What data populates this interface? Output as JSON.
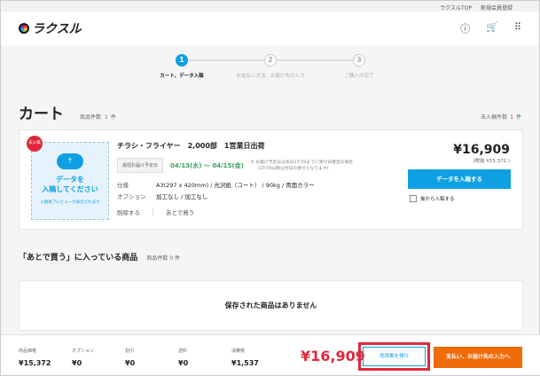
{
  "topbar": {
    "links": [
      "ラクスルTOP",
      "新規会員登録"
    ]
  },
  "header": {
    "logo": "ラクスル",
    "icons": [
      "help-icon",
      "cart-icon",
      "apps-grid-icon"
    ]
  },
  "stepper": {
    "current": 1,
    "steps": [
      {
        "num": "1",
        "label": "カート、データ入稿"
      },
      {
        "num": "2",
        "label": "お支払い方法、お届け先の入力"
      },
      {
        "num": "3",
        "label": "ご購入の完了"
      }
    ]
  },
  "cart": {
    "title": "カート",
    "count_label": "商品件数",
    "count": "1",
    "count_unit": "件",
    "pending_label": "未入稿件数",
    "pending": "1",
    "pending_unit": "件"
  },
  "item": {
    "badge": "未入稿",
    "upload_line1": "データを",
    "upload_line2": "入稿してください",
    "upload_note": "入稿後プレビューが表示されます",
    "name": "チラシ・フライヤー　2,000部　1営業日出荷",
    "date_label": "最短お届け予定日",
    "date": "04/13(水) 〜 04/15(金)",
    "date_note1": "※ お届け予定日は本日23:59までに受付日確定の場合",
    "date_note2": "(23:59以降は翌日の受付となります)",
    "spec_label": "仕様",
    "spec": "A3(297 x 420mm) / 光沢紙（コート） / 90kg / 両面カラー",
    "option_label": "オプション",
    "option": "加工なし / 加工なし",
    "delete": "削除する",
    "save_later": "あとで買う",
    "price": "¥16,909",
    "price_excl": "(税抜 ¥15,372 )",
    "upload_button": "データを入稿する",
    "later_checkbox": "後から入稿する",
    "accent": "#0ea0e3"
  },
  "saved": {
    "title": "「あとで買う」に入っている商品",
    "count_label": "商品件数",
    "count": "0",
    "count_unit": "件",
    "empty": "保存された商品はありません"
  },
  "footer": {
    "items": [
      {
        "label": "商品価格",
        "value": "¥15,372"
      },
      {
        "label": "オプション",
        "value": "¥0"
      },
      {
        "label": "割引",
        "value": "¥0"
      },
      {
        "label": "送料",
        "value": "¥0"
      },
      {
        "label": "消費税",
        "value": "¥1,537"
      }
    ],
    "total": "¥16,909",
    "quote_button": "見積書を発行",
    "next_button": "支払い、お届け先の入力へ",
    "next_color": "#f06b0a",
    "total_color": "#e0283a"
  }
}
